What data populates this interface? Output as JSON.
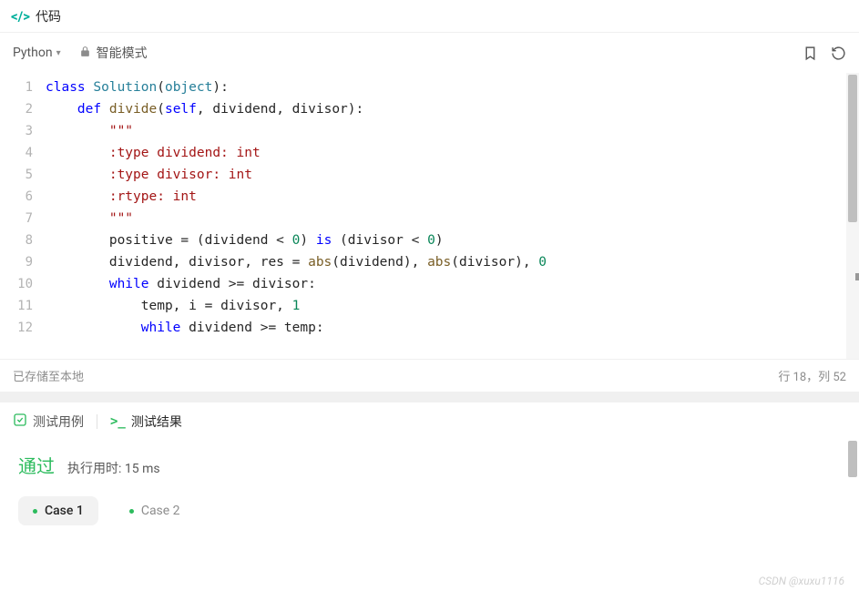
{
  "header": {
    "title": "代码"
  },
  "toolbar": {
    "language": "Python",
    "mode": "智能模式",
    "bookmark_tip": "Bookmark",
    "reset_tip": "Reset"
  },
  "editor": {
    "lines": [
      1,
      2,
      3,
      4,
      5,
      6,
      7,
      8,
      9,
      10,
      11,
      12
    ],
    "code": {
      "l1": {
        "kw": "class",
        "cls": " Solution",
        "p1": "(",
        "obj": "object",
        "p2": "):"
      },
      "l2": {
        "kw": "def",
        "fn": " divide",
        "p1": "(",
        "s": "self",
        "c1": ", ",
        "a1": "dividend",
        "c2": ", ",
        "a2": "divisor",
        "p2": "):"
      },
      "l3": "\"\"\"",
      "l4": ":type dividend: int",
      "l5": ":type divisor: int",
      "l6": ":rtype: int",
      "l7": "\"\"\"",
      "l8": {
        "v": "positive = (dividend < ",
        "n1": "0",
        "m": ") ",
        "kw": "is",
        "e": " (divisor < ",
        "n2": "0",
        "p": ")"
      },
      "l9": {
        "a": "dividend, divisor, res = ",
        "f1": "abs",
        "p1": "(dividend), ",
        "f2": "abs",
        "p2": "(divisor), ",
        "n": "0"
      },
      "l10": {
        "kw": "while",
        "e": " dividend >= divisor:"
      },
      "l11": {
        "a": "temp, i = divisor, ",
        "n": "1"
      },
      "l12": {
        "kw": "while",
        "e": " dividend >= temp:"
      }
    }
  },
  "status": {
    "saved": "已存储至本地",
    "cursor": "行 18，列 52"
  },
  "results": {
    "tab_testcase": "测试用例",
    "tab_results": "测试结果",
    "pass": "通过",
    "runtime_prefix": "执行用时: ",
    "runtime_value": "15 ms",
    "cases": [
      "Case 1",
      "Case 2"
    ]
  },
  "watermark": "CSDN @xuxu1116"
}
